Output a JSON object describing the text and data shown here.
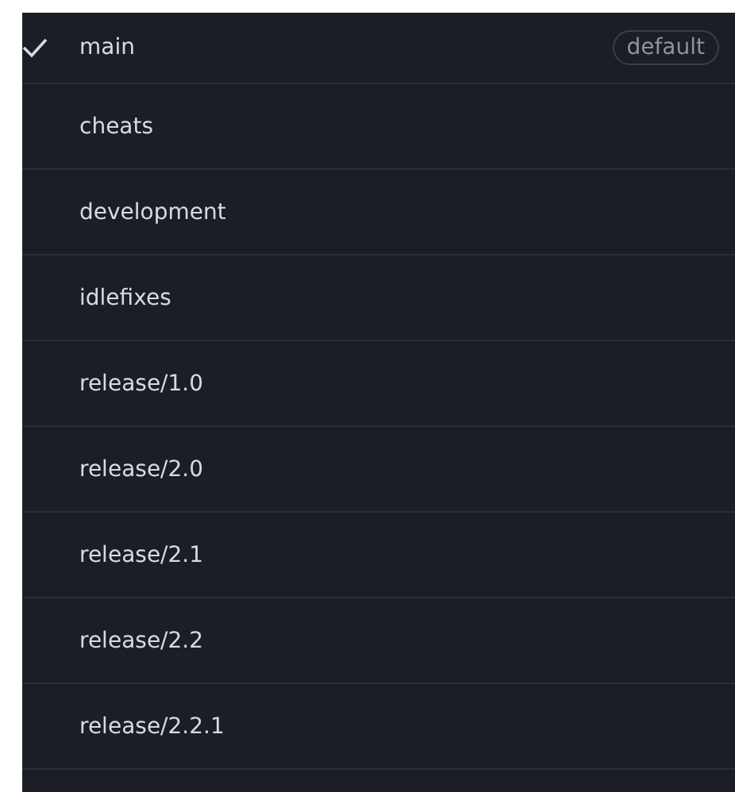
{
  "branches": [
    {
      "name": "main",
      "selected": true,
      "badge": "default"
    },
    {
      "name": "cheats",
      "selected": false
    },
    {
      "name": "development",
      "selected": false
    },
    {
      "name": "idlefixes",
      "selected": false
    },
    {
      "name": "release/1.0",
      "selected": false
    },
    {
      "name": "release/2.0",
      "selected": false
    },
    {
      "name": "release/2.1",
      "selected": false
    },
    {
      "name": "release/2.2",
      "selected": false
    },
    {
      "name": "release/2.2.1",
      "selected": false
    }
  ]
}
